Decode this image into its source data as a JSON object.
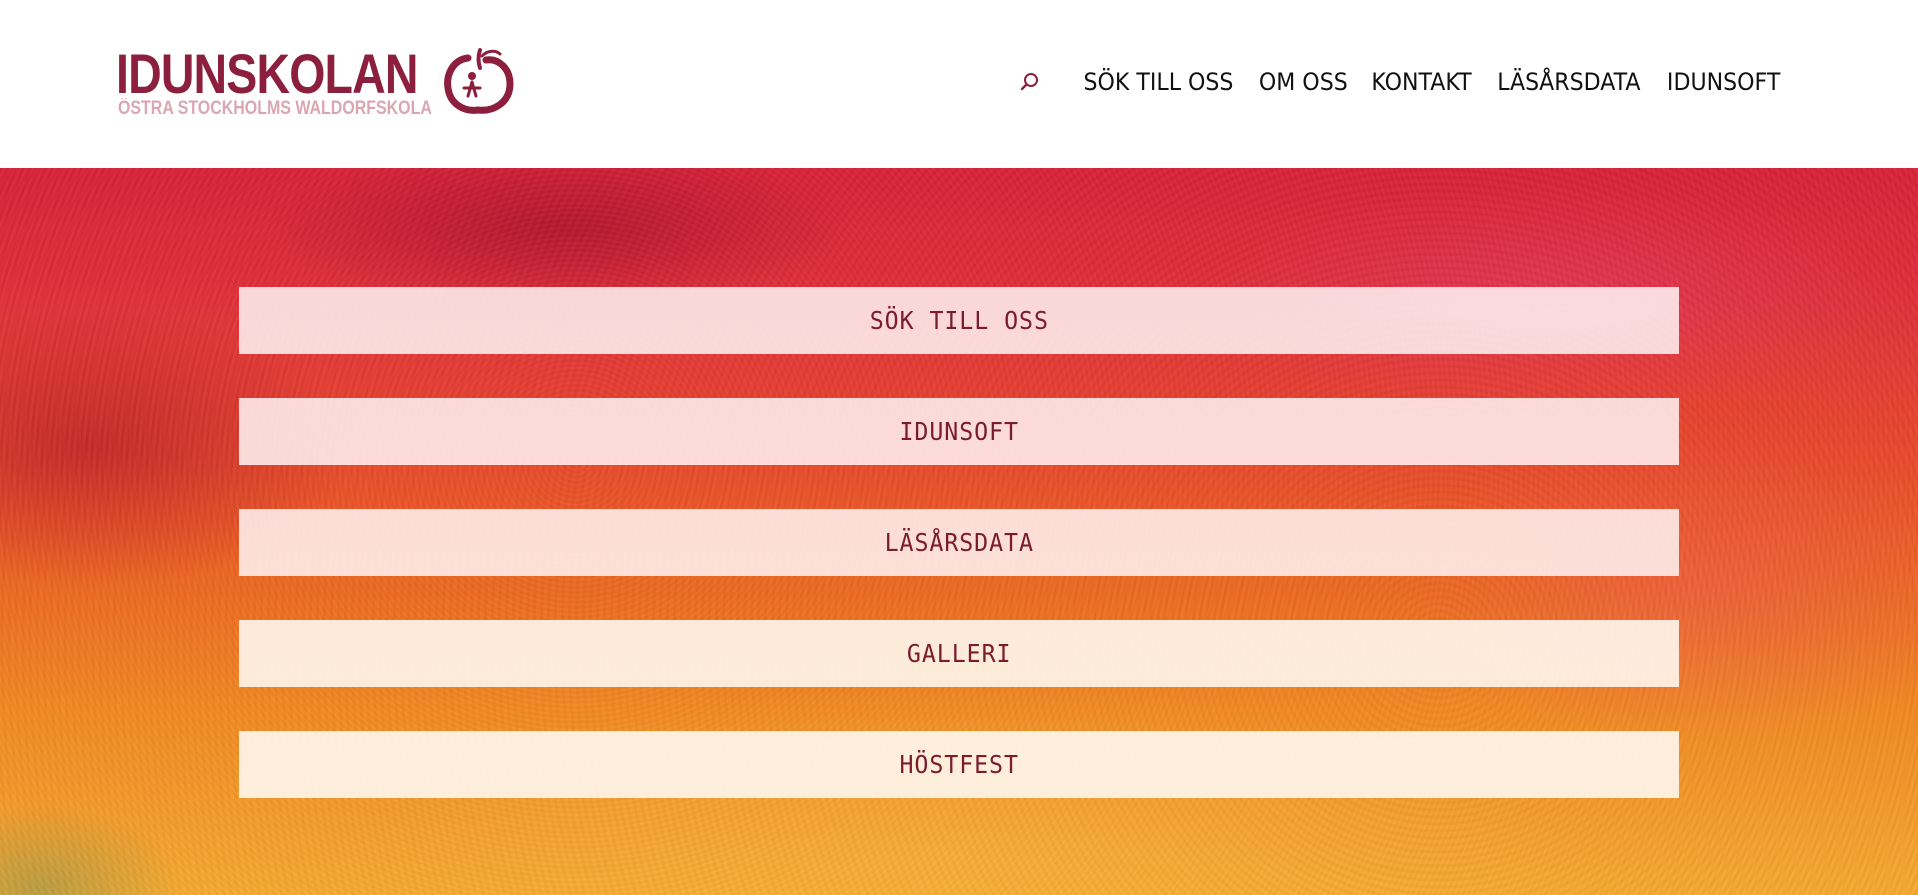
{
  "header": {
    "logo": {
      "wordmark": "IDUNSKOLAN",
      "subtitle": "ÖSTRA STOCKHOLMS WALDORFSKOLA"
    },
    "search_icon": "search-icon",
    "nav": [
      {
        "label": "SÖK TILL OSS"
      },
      {
        "label": "OM OSS"
      },
      {
        "label": "KONTAKT"
      },
      {
        "label": "LÄSÅRSDATA"
      },
      {
        "label": "IDUNSOFT"
      }
    ]
  },
  "hero": {
    "links": [
      {
        "label": "SÖK TILL OSS"
      },
      {
        "label": "IDUNSOFT"
      },
      {
        "label": "LÄSÅRSDATA"
      },
      {
        "label": "GALLERI"
      },
      {
        "label": "HÖSTFEST"
      }
    ]
  },
  "colors": {
    "brand": "#8c1f3e",
    "brand_light": "#dba6b2",
    "button_text": "#7a1b2e",
    "nav_text": "#111111"
  }
}
